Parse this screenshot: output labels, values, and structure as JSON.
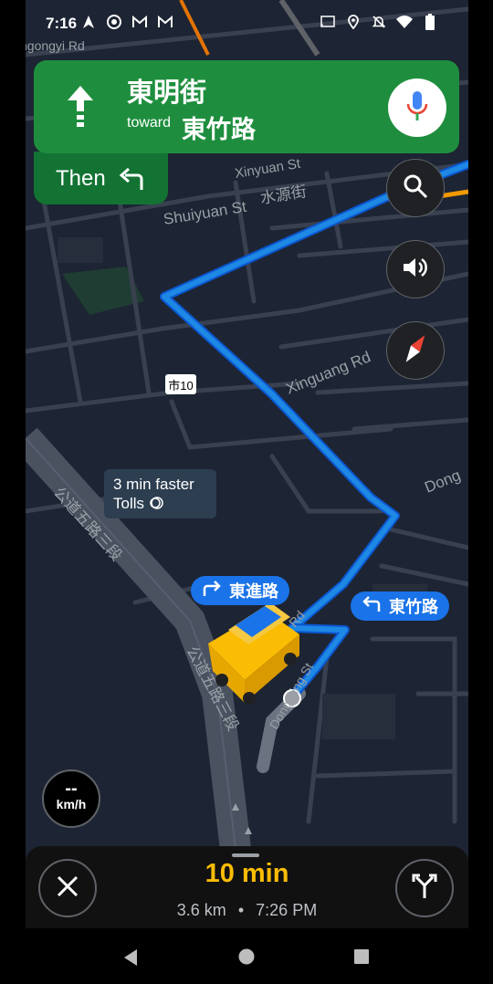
{
  "status_bar": {
    "time": "7:16",
    "left_icons": [
      "navigation-icon",
      "chrome-icon",
      "gmail-icon",
      "gmail-icon"
    ],
    "right_icons": [
      "cast-icon",
      "location-icon",
      "mute-icon",
      "wifi-icon",
      "battery-icon"
    ]
  },
  "navigation": {
    "street": "東明街",
    "toward_label": "toward",
    "toward_street": "東竹路",
    "then_label": "Then",
    "maneuver_icon": "straight-arrow-icon",
    "then_icon": "turn-left-icon"
  },
  "map": {
    "labels": {
      "gongyi": "ngongyi Rd",
      "xinyuan": "Xinyuan St",
      "shuiyuan": "Shuiyuan St",
      "shuiyuan_zh": "水源街",
      "xinguang": "Xinguang Rd",
      "route_shield": "市10",
      "dongming_partial": "Dong",
      "gongdao": "公道五路三段",
      "gongdao2": "公道五路三段",
      "dongming_st": "Dongming St",
      "rd": "Rd"
    },
    "callout_line1": "3 min faster",
    "callout_line2": "Tolls",
    "pill_right": "東進路",
    "pill_left": "東竹路"
  },
  "speed": {
    "value": "--",
    "unit": "km/h"
  },
  "trip": {
    "duration": "10 min",
    "distance": "3.6 km",
    "separator": "•",
    "arrival": "7:26 PM"
  },
  "colors": {
    "nav_green": "#1e8e3e",
    "then_green": "#137333",
    "route_blue": "#1e88e5",
    "eta_yellow": "#fbbc04",
    "map_bg": "#1d2433"
  }
}
